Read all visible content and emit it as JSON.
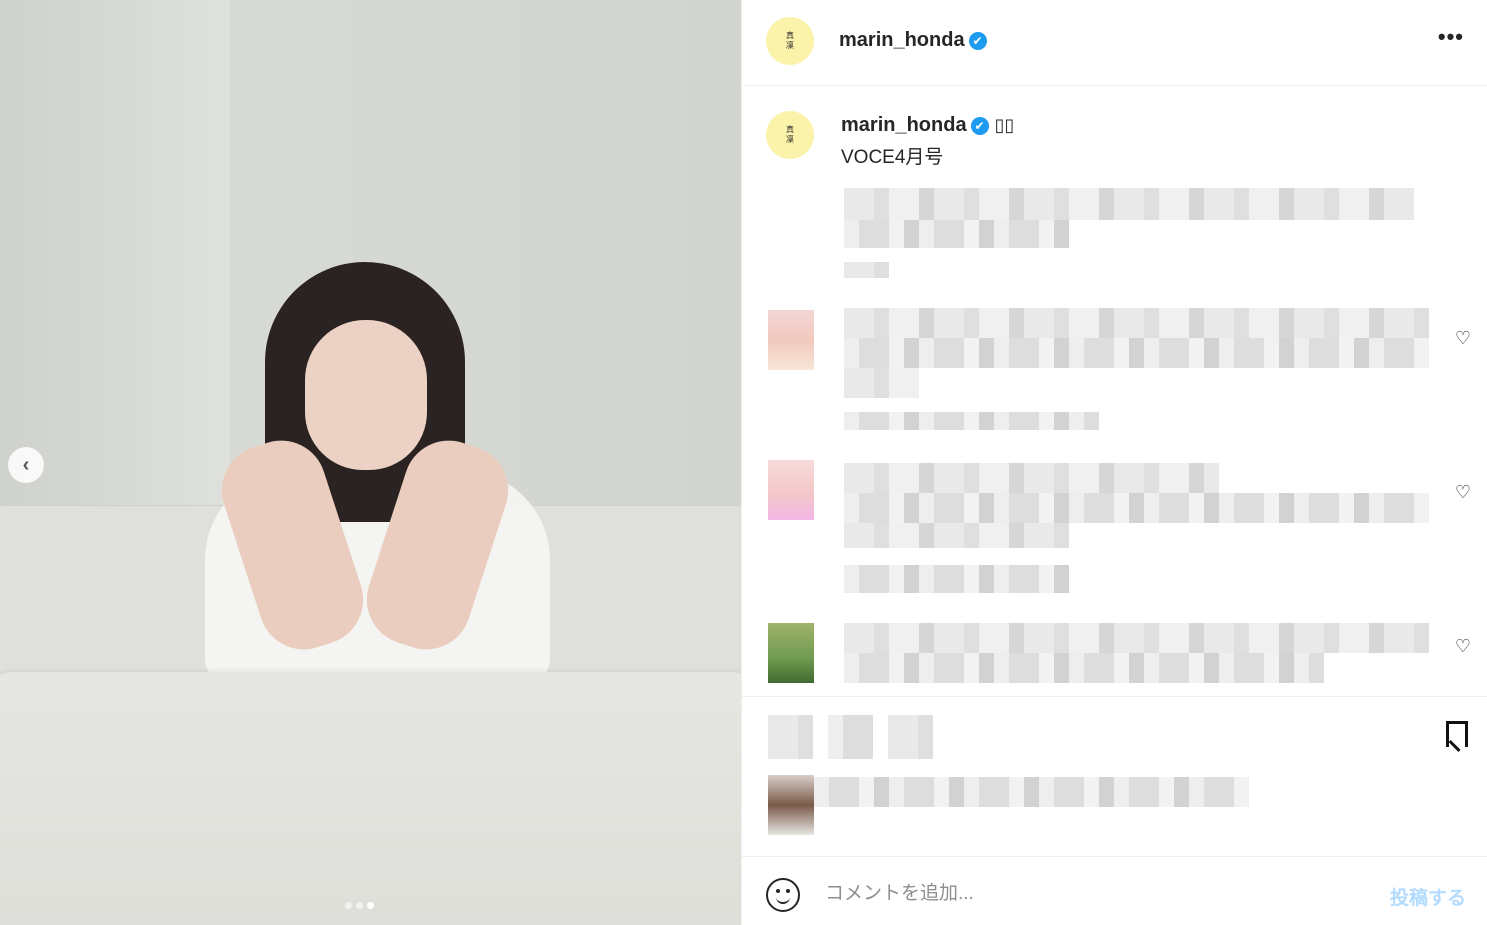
{
  "post": {
    "username": "marin_honda",
    "verified_mark": "✔",
    "more_label": "•••",
    "avatar_text": "真\n凜"
  },
  "caption": {
    "username": "marin_honda",
    "emoji": "▯▯",
    "text": "VOCE4月号"
  },
  "media": {
    "carousel_total": 3,
    "carousel_active": 3,
    "prev_glyph": "‹"
  },
  "comments": [
    {
      "like_icon": "♡"
    },
    {
      "like_icon": "♡"
    },
    {
      "like_icon": "♡"
    }
  ],
  "comment_bar": {
    "placeholder": "コメントを追加...",
    "post_label": "投稿する"
  },
  "colors": {
    "avatar_bg": "#fbf3a9",
    "verified": "#1d9bf0",
    "post_button": "#b3dbff"
  }
}
